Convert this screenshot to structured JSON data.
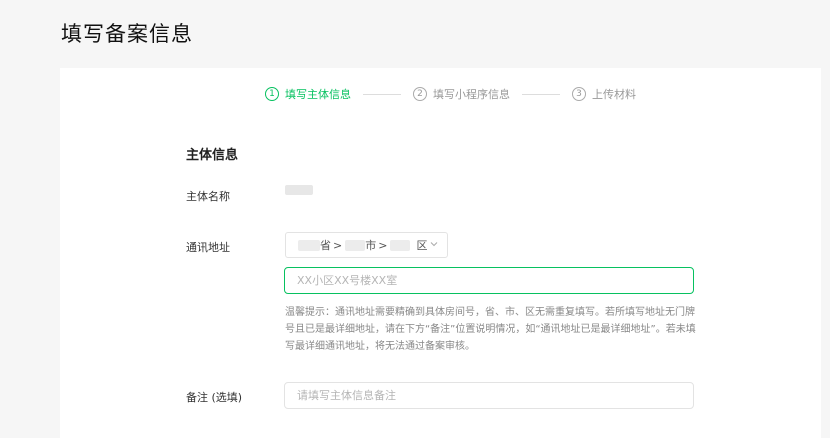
{
  "page": {
    "title": "填写备案信息"
  },
  "steps": [
    {
      "num": "1",
      "label": "填写主体信息",
      "active": true
    },
    {
      "num": "2",
      "label": "填写小程序信息",
      "active": false
    },
    {
      "num": "3",
      "label": "上传材料",
      "active": false
    }
  ],
  "section": {
    "title": "主体信息"
  },
  "fields": {
    "entity_name_label": "主体名称",
    "address_label": "通讯地址",
    "region": {
      "province_suffix": "省",
      "city_suffix": "市",
      "district_suffix": "区",
      "separator": ">"
    },
    "address_placeholder": "XX小区XX号楼XX室",
    "hint": "温馨提示：通讯地址需要精确到具体房间号，省、市、区无需重复填写。若所填写地址无门牌号且已是最详细地址，请在下方“备注”位置说明情况，如“通讯地址已是最详细地址”。若未填写最详细通讯地址，将无法通过备案审核。",
    "remark_label": "备注 (选填)",
    "remark_placeholder": "请填写主体信息备注"
  },
  "colors": {
    "accent": "#07c160",
    "background": "#f6f6f6"
  }
}
